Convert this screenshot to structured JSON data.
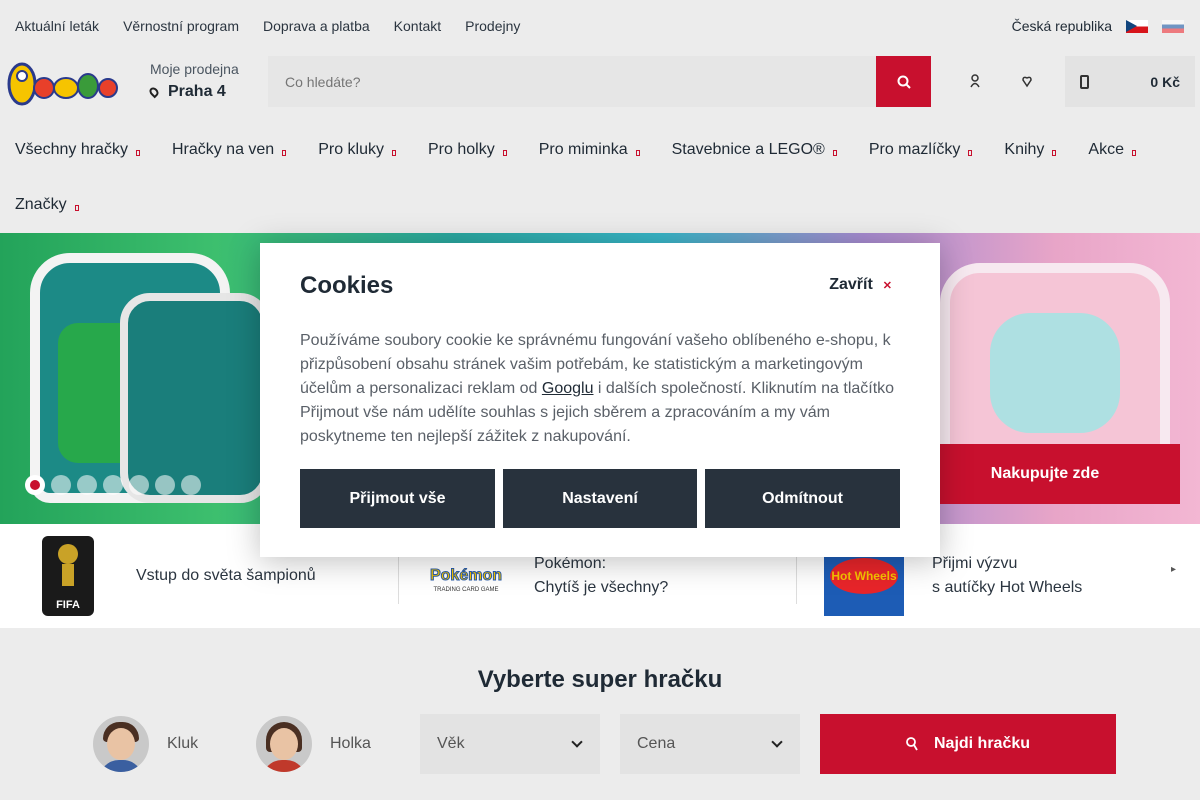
{
  "topbar": {
    "links": [
      "Aktuální leták",
      "Věrnostní program",
      "Doprava a platba",
      "Kontakt",
      "Prodejny"
    ],
    "country": "Česká republika"
  },
  "header": {
    "logo_text": "Pompo",
    "store_label": "Moje prodejna",
    "store_value": "Praha 4",
    "search_placeholder": "Co hledáte?",
    "cart_total": "0 Kč"
  },
  "nav": {
    "row1": [
      "Všechny hračky",
      "Hračky na ven",
      "Pro kluky",
      "Pro holky",
      "Pro miminka",
      "Stavebnice a LEGO®",
      "Pro mazlíčky",
      "Knihy",
      "Akce"
    ],
    "row2": [
      "Značky"
    ]
  },
  "banner": {
    "cta": "Nakupujte zde",
    "slides": 7,
    "active_slide": 1
  },
  "promos": [
    {
      "line1": "Vstup do světa šampionů",
      "line2": "",
      "image": "fifa-world-cup-logo"
    },
    {
      "line1": "Pokémon:",
      "line2": "Chytíš je všechny?",
      "image": "pokemon-tcg-logo"
    },
    {
      "line1": "Přijmi výzvu",
      "line2": "s autíčky Hot Wheels",
      "image": "hot-wheels-logo"
    }
  ],
  "finder": {
    "title": "Vyberte super hračku",
    "boy": "Kluk",
    "girl": "Holka",
    "age_label": "Věk",
    "price_label": "Cena",
    "button": "Najdi hračku"
  },
  "cookies": {
    "title": "Cookies",
    "close": "Zavřít",
    "text_before": "Používáme soubory cookie ke správnému fungování vašeho oblíbeného e-shopu, k přizpůsobení obsahu stránek vašim potřebám, ke statistickým a marketingovým účelům a personalizaci reklam od ",
    "link": "Googlu",
    "text_after": " i dalších společností. Kliknutím na tlačítko Přijmout vše nám udělíte souhlas s jejich sběrem a zpracováním a my vám poskytneme ten nejlepší zážitek z nakupování.",
    "accept": "Přijmout vše",
    "settings": "Nastavení",
    "reject": "Odmítnout"
  },
  "colors": {
    "accent": "#c8102e",
    "dark": "#28323d"
  }
}
